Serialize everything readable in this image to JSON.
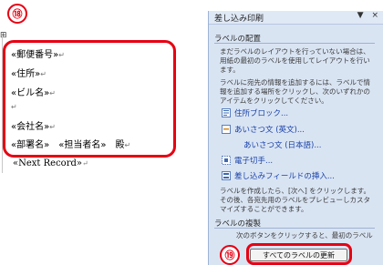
{
  "document": {
    "anchor_mark": "⊞",
    "annotation_left": "⑱",
    "fields": [
      {
        "text": "«郵便番号»",
        "mark": "↵"
      },
      {
        "text": "«住所»",
        "mark": "↵"
      },
      {
        "text": "«ビル名»",
        "mark": "↵"
      },
      {
        "text": "",
        "mark": "↵"
      },
      {
        "text": "«会社名»",
        "mark": "↵"
      },
      {
        "text": "«部署名»　«担当者名»　殿",
        "mark": "↵"
      }
    ],
    "next_record": "«Next Record»",
    "next_record_mark": "↵"
  },
  "pane": {
    "title": "差し込み印刷",
    "dropdown_icon": "▼",
    "close_icon": "×",
    "section_label_layout": "ラベルの配置",
    "desc_1": "まだラベルのレイアウトを行っていない場合は、用紙の最初のラベルを使用してレイアウトを行います。",
    "desc_2": "ラベルに宛先の情報を追加するには、ラベルで情報を追加する場所をクリックし、次のいずれかのアイテムをクリックしてください。",
    "items": [
      {
        "label": "住所ブロック...",
        "icon": "address-block-icon"
      },
      {
        "label": "あいさつ文 (英文)...",
        "icon": "greeting-line-icon"
      },
      {
        "label": "あいさつ文 (日本語)...",
        "icon": ""
      },
      {
        "label": "電子切手...",
        "icon": "postage-icon"
      },
      {
        "label": "差し込みフィールドの挿入...",
        "icon": "merge-field-icon"
      }
    ],
    "desc_3": "ラベルを作成したら、[次へ] をクリックします。その後、各宛先用のラベルをプレビューしカスタマイズすることができます。",
    "section_label_copy": "ラベルの複製",
    "desc_4": "次のボタンをクリックすると、最初のラベルのレイアウトをページの他のラベルにコピーできます。",
    "update_button": "すべてのラベルの更新",
    "annotation_right": "⑲"
  }
}
